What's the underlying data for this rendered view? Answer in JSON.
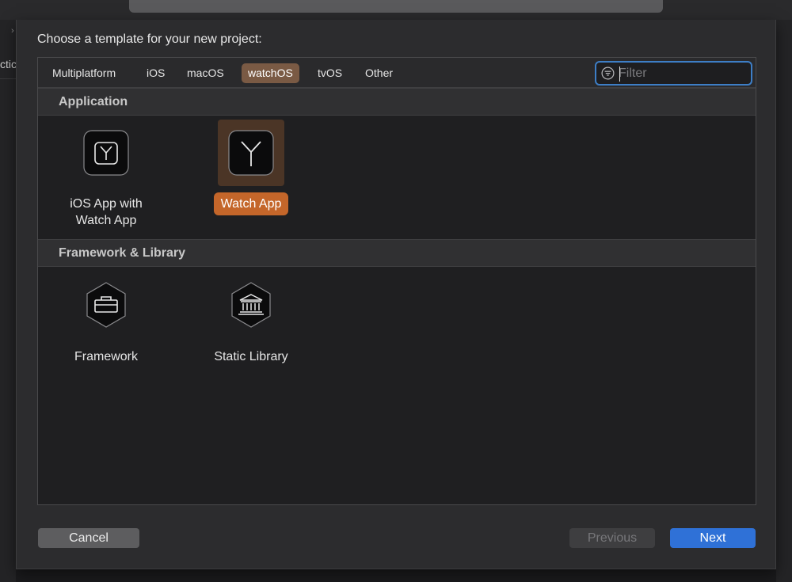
{
  "dialog": {
    "title": "Choose a template for your new project:"
  },
  "background": {
    "left_fragment": "ctic"
  },
  "platform_tabs": [
    {
      "label": "Multiplatform",
      "selected": false
    },
    {
      "label": "iOS",
      "selected": false
    },
    {
      "label": "macOS",
      "selected": false
    },
    {
      "label": "watchOS",
      "selected": true
    },
    {
      "label": "tvOS",
      "selected": false
    },
    {
      "label": "Other",
      "selected": false
    }
  ],
  "filter": {
    "placeholder": "Filter",
    "value": ""
  },
  "sections": [
    {
      "title": "Application",
      "templates": [
        {
          "label": "iOS App with Watch App",
          "icon": "watch-face-icon",
          "selected": false
        },
        {
          "label": "Watch App",
          "icon": "watch-face-icon",
          "selected": true
        }
      ]
    },
    {
      "title": "Framework & Library",
      "templates": [
        {
          "label": "Framework",
          "icon": "toolbox-icon",
          "selected": false
        },
        {
          "label": "Static Library",
          "icon": "library-building-icon",
          "selected": false
        }
      ]
    }
  ],
  "buttons": {
    "cancel": "Cancel",
    "previous": "Previous",
    "next": "Next"
  },
  "colors": {
    "accent_selection": "#c4662a",
    "tab_selected": "#7a5a44",
    "primary_button": "#2f71d7",
    "focus_ring": "#3d7ec6"
  }
}
